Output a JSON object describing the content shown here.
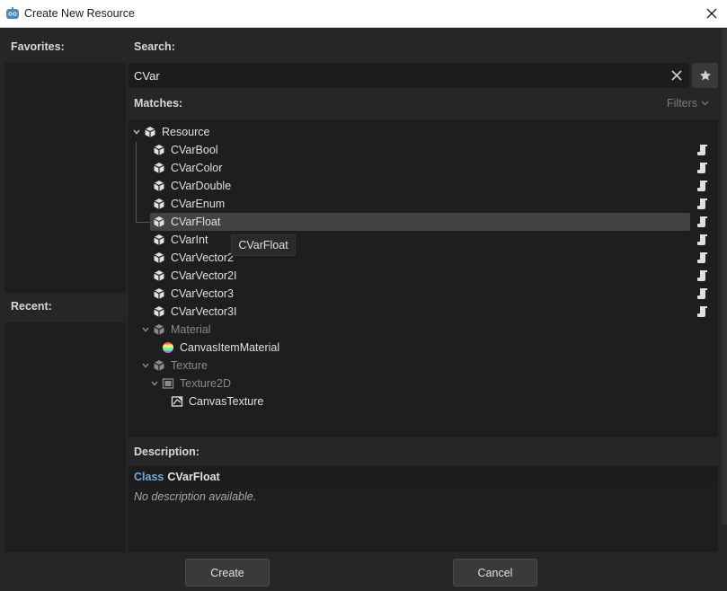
{
  "window": {
    "title": "Create New Resource"
  },
  "favorites": {
    "label": "Favorites:"
  },
  "recent": {
    "label": "Recent:"
  },
  "search": {
    "label": "Search:",
    "value": "CVar"
  },
  "matches": {
    "label": "Matches:",
    "filters_label": "Filters"
  },
  "tree": {
    "root": "Resource",
    "cvar_items": [
      "CVarBool",
      "CVarColor",
      "CVarDouble",
      "CVarEnum",
      "CVarFloat",
      "CVarInt",
      "CVarVector2",
      "CVarVector2I",
      "CVarVector3",
      "CVarVector3I"
    ],
    "material": "Material",
    "canvas_item_material": "CanvasItemMaterial",
    "texture": "Texture",
    "texture2d": "Texture2D",
    "canvas_texture": "CanvasTexture",
    "selected": "CVarFloat"
  },
  "tooltip": {
    "text": "CVarFloat"
  },
  "description": {
    "label": "Description:",
    "class_keyword": "Class",
    "class_name": "CVarFloat",
    "body": "No description available."
  },
  "buttons": {
    "create": "Create",
    "cancel": "Cancel"
  },
  "colors": {
    "accent": "#70a9e0",
    "background": "#262626",
    "panel": "#1e1e1e",
    "selection": "#434343"
  },
  "icons": {
    "app": "godot-icon",
    "close": "close-icon",
    "clear": "clear-icon",
    "favorite": "star-icon",
    "resource": "cube-icon",
    "script": "script-icon",
    "material": "material-icon",
    "texture2d": "texture2d-icon",
    "canvas_texture": "canvas-texture-icon"
  }
}
